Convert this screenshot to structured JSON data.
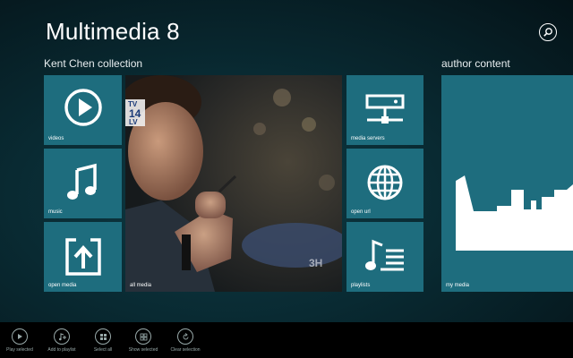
{
  "app": {
    "title": "Multimedia 8"
  },
  "sections": {
    "collection_title": "Kent Chen collection",
    "author_title": "author content"
  },
  "tiles": {
    "videos": "videos",
    "music": "music",
    "open_media": "open media",
    "all_media": "all media",
    "media_servers": "media servers",
    "open_url": "open url",
    "playlists": "playlists",
    "my_media": "my media"
  },
  "photo_overlay": {
    "channel_top": "TV",
    "channel_num": "14",
    "channel_bottom": "LV",
    "watermark": "3H"
  },
  "icons": {
    "search": "search-icon",
    "videos": "play-icon",
    "music": "music-note-icon",
    "open_media": "open-share-icon",
    "media_servers": "network-server-icon",
    "open_url": "globe-icon",
    "playlists": "playlist-icon"
  },
  "appbar": [
    {
      "label": "Play selected",
      "icon": "play-icon"
    },
    {
      "label": "Add to playlist",
      "icon": "add-playlist-icon"
    },
    {
      "label": "Select all",
      "icon": "select-all-icon"
    },
    {
      "label": "Show selected",
      "icon": "show-selected-icon"
    },
    {
      "label": "Clear selection",
      "icon": "clear-selection-icon"
    }
  ],
  "colors": {
    "tile": "#1e6d7e",
    "background": "#092a32",
    "appbar": "#000000"
  }
}
